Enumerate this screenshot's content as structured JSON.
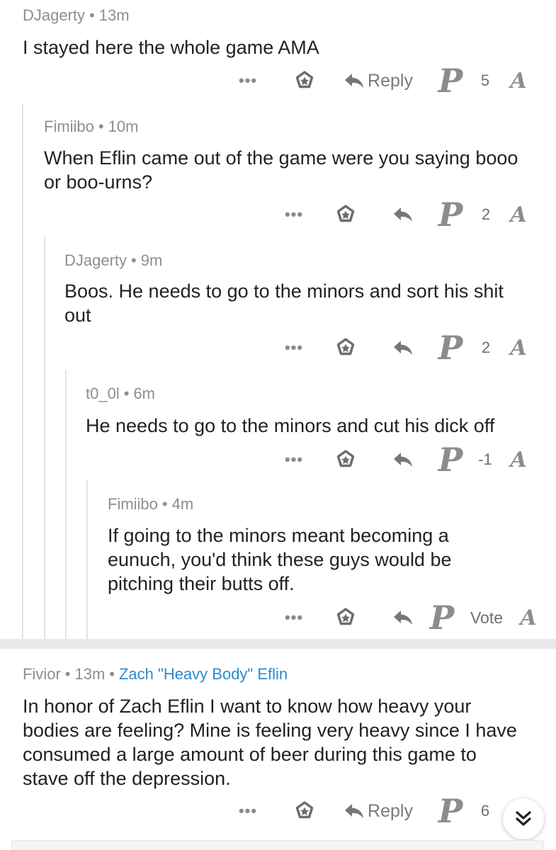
{
  "comments": [
    {
      "author": "DJagerty",
      "time": "13m",
      "body": "I stayed here the whole game AMA",
      "more": "•••",
      "reply_label": "Reply",
      "score": "5"
    },
    {
      "author": "Fimiibo",
      "time": "10m",
      "body": "When Eflin came out of the game were you saying booo or boo-urns?",
      "more": "•••",
      "score": "2"
    },
    {
      "author": "DJagerty",
      "time": "9m",
      "body": "Boos. He needs to go to the minors and sort his shit out",
      "more": "•••",
      "score": "2"
    },
    {
      "author": "t0_0l",
      "time": "6m",
      "body": "He needs to go to the minors and cut his dick off",
      "more": "•••",
      "score": "-1"
    },
    {
      "author": "Fimiibo",
      "time": "4m",
      "body": "If going to the minors meant becoming a eunuch, you'd think these guys would be pitching their butts off.",
      "more": "•••",
      "score": "Vote"
    },
    {
      "author": "Fivior",
      "time": "13m",
      "flair": "Zach \"Heavy Body\" Eflin",
      "body": "In honor of Zach Eflin I want to know how heavy your bodies are feeling?  Mine is feeling very heavy since I have consumed a large amount of beer during this game to stave off the depression.",
      "more": "•••",
      "reply_label": "Reply",
      "score": "6"
    }
  ],
  "separator_dot": "•",
  "upvote_logo": "P",
  "downvote_logo": "A",
  "icons": {
    "more": "ellipsis-icon",
    "save": "star-icon",
    "reply": "reply-arrow-icon",
    "upvote": "phillies-p-logo-icon",
    "downvote": "braves-a-logo-icon",
    "scroll": "double-chevron-down-icon"
  },
  "colors": {
    "meta_text": "#8e8e8e",
    "flair": "#2a8bd2",
    "icon": "#7a7a7a",
    "thread_line": "#e3e3e3",
    "separator": "#e9e9e9"
  }
}
